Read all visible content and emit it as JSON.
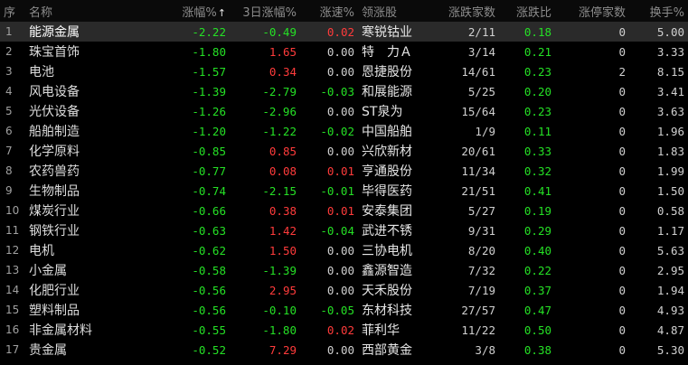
{
  "colors": {
    "up": "#ff3b3b",
    "down": "#25e025",
    "flat": "#d0d0d0",
    "background": "#000000",
    "header_text": "#8c8c8c"
  },
  "header": {
    "idx": "序",
    "name": "名称",
    "change_pct": "涨幅%",
    "change_3d": "3日涨幅%",
    "speed": "涨速%",
    "leader": "领涨股",
    "up_down_count": "涨跌家数",
    "up_down_ratio": "涨跌比",
    "limit_up_count": "涨停家数",
    "turnover": "换手%",
    "sort_icon": "↑"
  },
  "rows": [
    {
      "idx": "1",
      "name": "能源金属",
      "chg": "-2.22",
      "chg3": "-0.49",
      "speed": "0.02",
      "lead": "寒锐钴业",
      "count": "2/11",
      "ratio": "0.18",
      "limit": "0",
      "turn": "5.00"
    },
    {
      "idx": "2",
      "name": "珠宝首饰",
      "chg": "-1.80",
      "chg3": "1.65",
      "speed": "0.00",
      "lead": "特　力Ａ",
      "count": "3/14",
      "ratio": "0.21",
      "limit": "0",
      "turn": "3.33"
    },
    {
      "idx": "3",
      "name": "电池",
      "chg": "-1.57",
      "chg3": "0.34",
      "speed": "0.00",
      "lead": "恩捷股份",
      "count": "14/61",
      "ratio": "0.23",
      "limit": "2",
      "turn": "8.15"
    },
    {
      "idx": "4",
      "name": "风电设备",
      "chg": "-1.39",
      "chg3": "-2.79",
      "speed": "-0.03",
      "lead": "和展能源",
      "count": "5/25",
      "ratio": "0.20",
      "limit": "0",
      "turn": "3.41"
    },
    {
      "idx": "5",
      "name": "光伏设备",
      "chg": "-1.26",
      "chg3": "-2.96",
      "speed": "0.00",
      "lead": "ST泉为",
      "count": "15/64",
      "ratio": "0.23",
      "limit": "0",
      "turn": "3.63"
    },
    {
      "idx": "6",
      "name": "船舶制造",
      "chg": "-1.20",
      "chg3": "-1.22",
      "speed": "-0.02",
      "lead": "中国船舶",
      "count": "1/9",
      "ratio": "0.11",
      "limit": "0",
      "turn": "1.96"
    },
    {
      "idx": "7",
      "name": "化学原料",
      "chg": "-0.85",
      "chg3": "0.85",
      "speed": "0.00",
      "lead": "兴欣新材",
      "count": "20/61",
      "ratio": "0.33",
      "limit": "0",
      "turn": "1.83"
    },
    {
      "idx": "8",
      "name": "农药兽药",
      "chg": "-0.77",
      "chg3": "0.08",
      "speed": "0.01",
      "lead": "亨通股份",
      "count": "11/34",
      "ratio": "0.32",
      "limit": "0",
      "turn": "1.99"
    },
    {
      "idx": "9",
      "name": "生物制品",
      "chg": "-0.74",
      "chg3": "-2.15",
      "speed": "-0.01",
      "lead": "毕得医药",
      "count": "21/51",
      "ratio": "0.41",
      "limit": "0",
      "turn": "1.50"
    },
    {
      "idx": "10",
      "name": "煤炭行业",
      "chg": "-0.66",
      "chg3": "0.38",
      "speed": "0.01",
      "lead": "安泰集团",
      "count": "5/27",
      "ratio": "0.19",
      "limit": "0",
      "turn": "0.58"
    },
    {
      "idx": "11",
      "name": "钢铁行业",
      "chg": "-0.63",
      "chg3": "1.42",
      "speed": "-0.04",
      "lead": "武进不锈",
      "count": "9/31",
      "ratio": "0.29",
      "limit": "0",
      "turn": "1.17"
    },
    {
      "idx": "12",
      "name": "电机",
      "chg": "-0.62",
      "chg3": "1.50",
      "speed": "0.00",
      "lead": "三协电机",
      "count": "8/20",
      "ratio": "0.40",
      "limit": "0",
      "turn": "5.63"
    },
    {
      "idx": "13",
      "name": "小金属",
      "chg": "-0.58",
      "chg3": "-1.39",
      "speed": "0.00",
      "lead": "鑫源智造",
      "count": "7/32",
      "ratio": "0.22",
      "limit": "0",
      "turn": "2.95"
    },
    {
      "idx": "14",
      "name": "化肥行业",
      "chg": "-0.56",
      "chg3": "2.95",
      "speed": "0.00",
      "lead": "天禾股份",
      "count": "7/19",
      "ratio": "0.37",
      "limit": "0",
      "turn": "1.94"
    },
    {
      "idx": "15",
      "name": "塑料制品",
      "chg": "-0.56",
      "chg3": "-0.10",
      "speed": "-0.05",
      "lead": "东材科技",
      "count": "27/57",
      "ratio": "0.47",
      "limit": "0",
      "turn": "4.93"
    },
    {
      "idx": "16",
      "name": "非金属材料",
      "chg": "-0.55",
      "chg3": "-1.80",
      "speed": "0.02",
      "lead": "菲利华",
      "count": "11/22",
      "ratio": "0.50",
      "limit": "0",
      "turn": "4.87"
    },
    {
      "idx": "17",
      "name": "贵金属",
      "chg": "-0.52",
      "chg3": "7.29",
      "speed": "0.00",
      "lead": "西部黄金",
      "count": "3/8",
      "ratio": "0.38",
      "limit": "0",
      "turn": "5.30"
    }
  ]
}
